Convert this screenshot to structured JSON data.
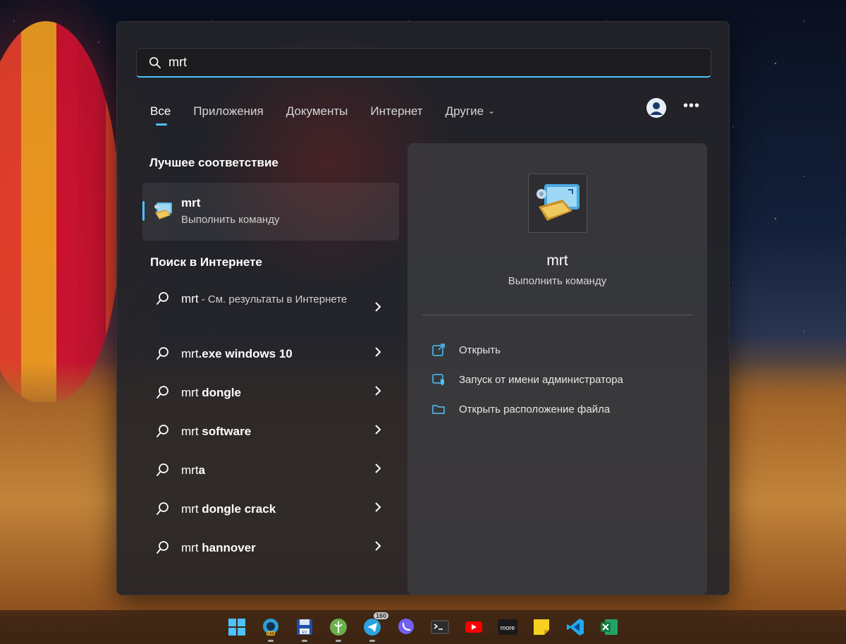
{
  "search": {
    "value": "mrt"
  },
  "tabs": [
    {
      "label": "Все",
      "active": true
    },
    {
      "label": "Приложения"
    },
    {
      "label": "Документы"
    },
    {
      "label": "Интернет"
    },
    {
      "label": "Другие"
    }
  ],
  "sections": {
    "best_match": "Лучшее соответствие",
    "web_search": "Поиск в Интернете"
  },
  "best_match": {
    "name": "mrt",
    "type": "Выполнить команду"
  },
  "web_results": [
    {
      "query": "mrt",
      "suffix": " - См. результаты в Интернете"
    },
    {
      "query_prefix": "mrt",
      "query_rest": ".exe windows 10"
    },
    {
      "query_prefix": "mrt",
      "query_rest": " dongle"
    },
    {
      "query_prefix": "mrt",
      "query_rest": " software"
    },
    {
      "query_prefix": "mrt",
      "query_rest": "a"
    },
    {
      "query_prefix": "mrt",
      "query_rest": " dongle crack"
    },
    {
      "query_prefix": "mrt",
      "query_rest": " hannover"
    }
  ],
  "preview": {
    "title": "mrt",
    "subtitle": "Выполнить команду",
    "actions": [
      {
        "label": "Открыть",
        "icon": "open-external-icon"
      },
      {
        "label": "Запуск от имени администратора",
        "icon": "admin-shield-icon"
      },
      {
        "label": "Открыть расположение файла",
        "icon": "folder-icon"
      }
    ]
  },
  "taskbar": {
    "apps": [
      "start",
      "edge-canary",
      "save-app",
      "app-green",
      "telegram",
      "viber",
      "terminal",
      "youtube",
      "more-app",
      "sticky-notes",
      "vscode",
      "excel"
    ],
    "telegram_badge": "160",
    "edge_label": "CAN",
    "save_label": "EV",
    "more_label": "more"
  },
  "colors": {
    "accent": "#4cc2ff"
  }
}
